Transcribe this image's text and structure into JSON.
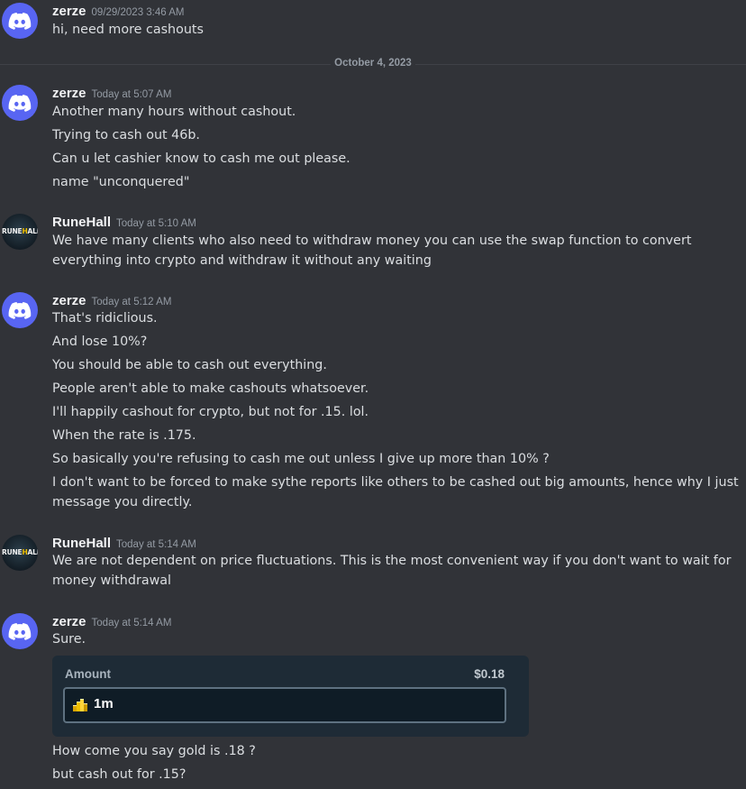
{
  "divider": {
    "label": "October 4, 2023"
  },
  "messages": [
    {
      "author": "zerze",
      "timestamp": "09/29/2023 3:46 AM",
      "avatar": "discord-logo-icon",
      "lines": [
        "hi, need more cashouts"
      ]
    },
    {
      "author": "zerze",
      "timestamp": "Today at 5:07 AM",
      "avatar": "discord-logo-icon",
      "lines": [
        "Another many hours without cashout.",
        "Trying to cash out 46b.",
        "Can u let cashier know to cash me out please.",
        "name \"unconquered\""
      ]
    },
    {
      "author": "RuneHall",
      "timestamp": "Today at 5:10 AM",
      "avatar": "runehall-logo",
      "avatar_text": {
        "part1": "RUNE",
        "part2": "H",
        "part3": "ALL"
      },
      "lines": [
        "We have many clients who also need to withdraw money you can use the swap function to convert everything into crypto and withdraw it without any waiting"
      ]
    },
    {
      "author": "zerze",
      "timestamp": "Today at 5:12 AM",
      "avatar": "discord-logo-icon",
      "lines": [
        "That's ridiclious.",
        "And lose 10%?",
        "You should be able to cash out everything.",
        "People aren't able to make cashouts whatsoever.",
        "I'll happily cashout for crypto, but not for .15. lol.",
        "When the rate is .175.",
        "So basically you're refusing to cash me out unless I give up more than 10% ?",
        "I don't want to be forced to make sythe reports like others to be cashed out big amounts, hence why I just message you directly."
      ]
    },
    {
      "author": "RuneHall",
      "timestamp": "Today at 5:14 AM",
      "avatar": "runehall-logo",
      "avatar_text": {
        "part1": "RUNE",
        "part2": "H",
        "part3": "ALL"
      },
      "lines": [
        "We are not dependent on price fluctuations. This is the most convenient way if you don't want to wait for money withdrawal"
      ]
    },
    {
      "author": "zerze",
      "timestamp": "Today at 5:14 AM",
      "avatar": "discord-logo-icon",
      "lines": [
        "Sure.",
        "How come you say gold is .18 ?",
        "but cash out for .15?"
      ],
      "embed": {
        "title": "Amount",
        "value": "$0.18",
        "field_value": "1m",
        "field_icon": "gold-coins-icon"
      }
    }
  ],
  "colors": {
    "background": "#313338",
    "discord_blurple": "#5865f2",
    "text": "#dbdee1",
    "author": "#f2f3f5",
    "muted": "#949ba4",
    "embed_bg": "#1e2b36",
    "field_bg": "#0f1c26",
    "field_border": "#5e7180",
    "gold": "#f0c000"
  }
}
